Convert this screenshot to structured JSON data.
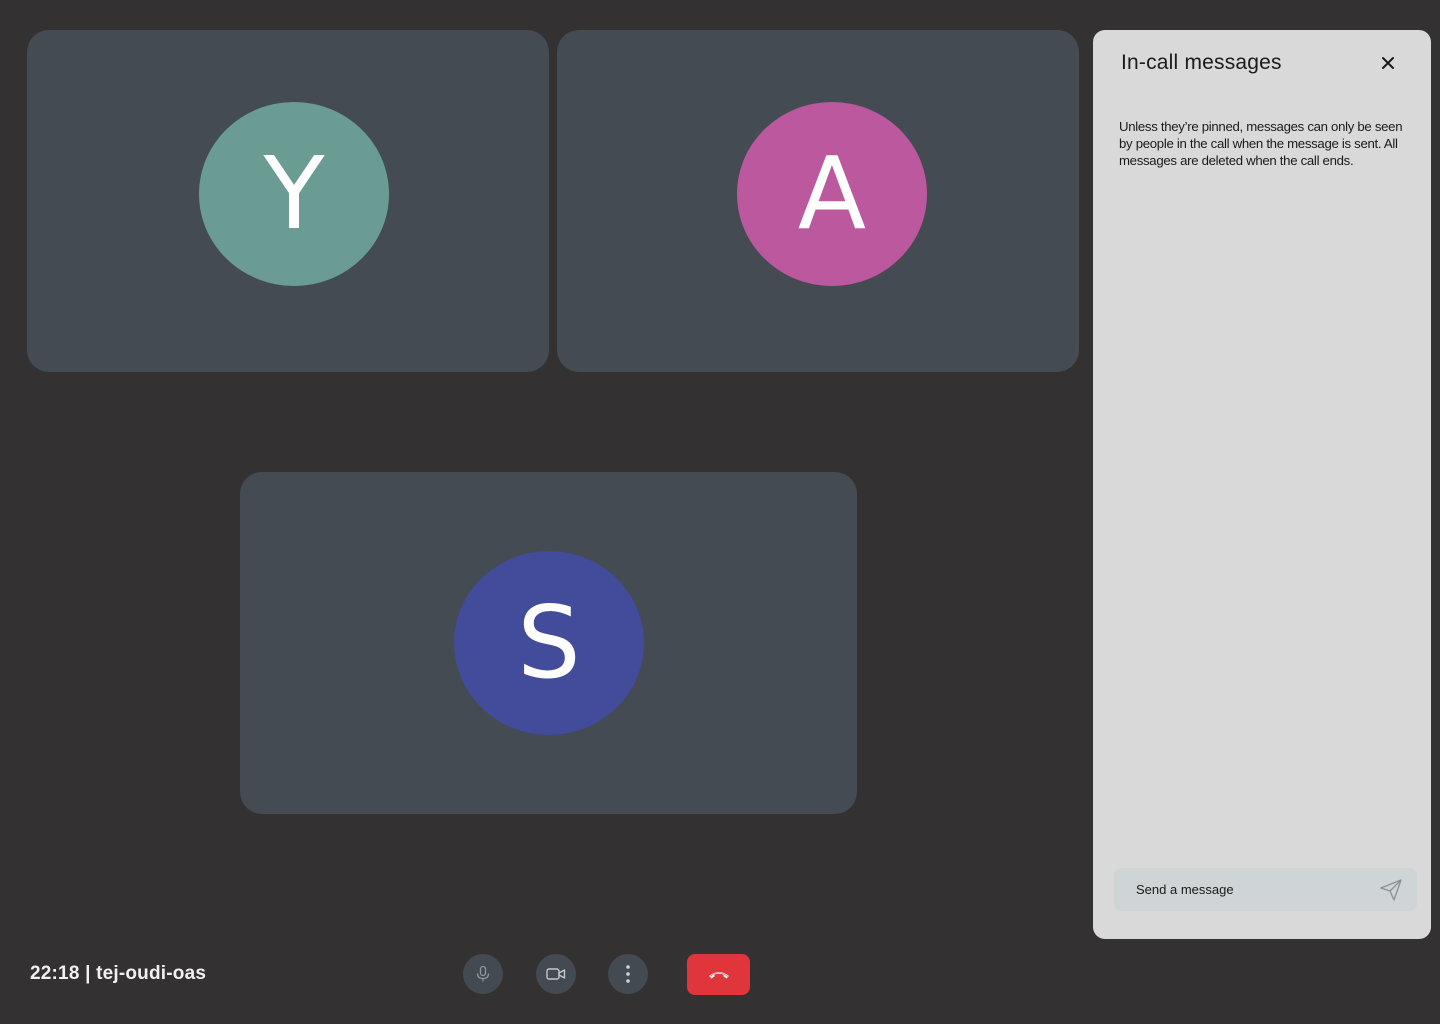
{
  "participants": [
    {
      "initial": "Y",
      "color": "#6a9c94"
    },
    {
      "initial": "A",
      "color": "#bb589e"
    },
    {
      "initial": "S",
      "color": "#434b9b"
    }
  ],
  "chat_panel": {
    "title": "In-call messages",
    "close_icon": "close-icon",
    "notice": "Unless they’re pinned, messages can only be seen by people in the call when the message is sent. All messages are deleted when the call ends.",
    "input_placeholder": "Send a message",
    "send_icon": "send-icon"
  },
  "footer": {
    "meeting_info": "22:18 | tej-oudi-oas"
  },
  "controls": {
    "mic_icon": "mic-icon",
    "camera_icon": "camera-icon",
    "more_icon": "more-vert-icon",
    "end_call_icon": "end-call-icon",
    "end_call_color": "#e0353a"
  },
  "colors": {
    "background": "#333132",
    "tile": "#444b52",
    "panel": "#d9d9d9"
  }
}
